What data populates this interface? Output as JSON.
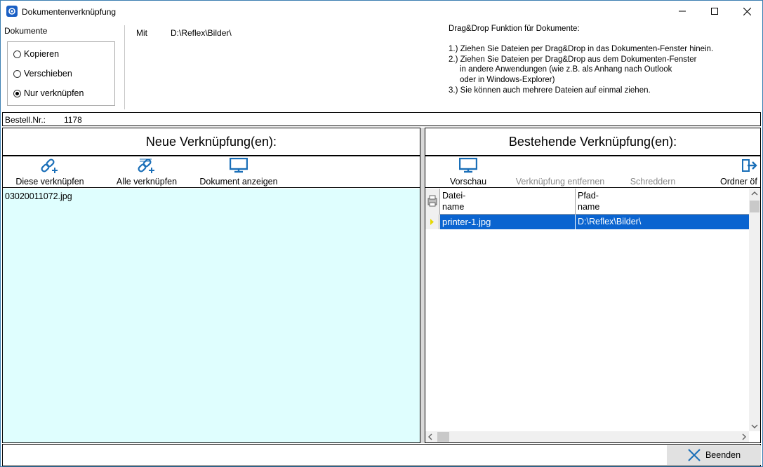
{
  "window": {
    "title": "Dokumentenverknüpfung",
    "controls": [
      "minimize-icon",
      "maximize-icon",
      "close-icon"
    ]
  },
  "documents": {
    "group_label": "Dokumente",
    "options": [
      {
        "label": "Kopieren",
        "selected": false
      },
      {
        "label": "Verschieben",
        "selected": false
      },
      {
        "label": "Nur verknüpfen",
        "selected": true
      }
    ],
    "with_label": "Mit",
    "path": "D:\\Reflex\\Bilder\\"
  },
  "help_text": {
    "title": "Drag&Drop Funktion für Dokumente:",
    "lines": [
      "1.) Ziehen Sie Dateien per Drag&Drop in das Dokumenten-Fenster hinein.",
      "2.) Ziehen Sie Dateien per Drag&Drop aus dem Dokumenten-Fenster",
      "     in andere Anwendungen (wie z.B. als Anhang nach Outlook",
      "     oder in Windows-Explorer)",
      "3.) Sie können auch mehrere Dateien auf einmal ziehen."
    ]
  },
  "order": {
    "label": "Bestell.Nr.:",
    "value": "1178"
  },
  "new_links": {
    "heading": "Neue Verknüpfung(en):",
    "toolbar": {
      "link_this": "Diese verknüpfen",
      "link_all": "Alle verknüpfen",
      "show_document": "Dokument anzeigen"
    },
    "items": [
      "03020011072.jpg"
    ]
  },
  "existing_links": {
    "heading": "Bestehende Verknüpfung(en):",
    "toolbar": {
      "preview": "Vorschau",
      "remove_link": "Verknüpfung entfernen",
      "shred": "Schreddern",
      "open_folder": "Ordner öf"
    },
    "columns": {
      "file_name": "Datei-\nname",
      "path_name": "Pfad-\nname"
    },
    "rows": [
      {
        "file_name": "printer-1.jpg",
        "path_name": "D:\\Reflex\\Bilder\\"
      }
    ]
  },
  "footer": {
    "close_label": "Beenden"
  },
  "colors": {
    "selection": "#0a64d0",
    "new_list_bg": "#dffefe",
    "icon_blue": "#1a6fb8"
  }
}
